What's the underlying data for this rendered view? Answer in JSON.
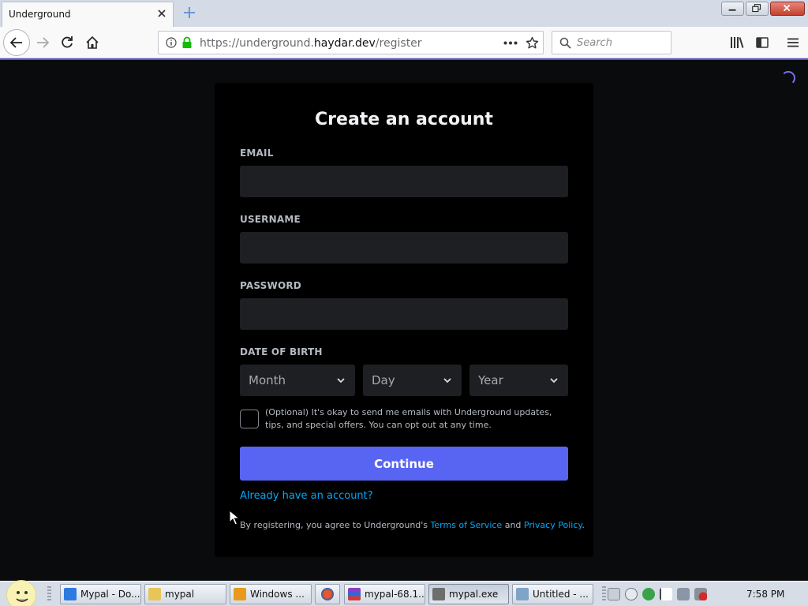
{
  "browser": {
    "tab_title": "Underground",
    "url_prefix": "https://underground.",
    "url_domain": "haydar.dev",
    "url_path": "/register",
    "search_placeholder": "Search"
  },
  "form": {
    "title": "Create an account",
    "email_label": "EMAIL",
    "username_label": "USERNAME",
    "password_label": "PASSWORD",
    "dob_label": "DATE OF BIRTH",
    "month_placeholder": "Month",
    "day_placeholder": "Day",
    "year_placeholder": "Year",
    "optin_text": "(Optional) It's okay to send me emails with Underground updates, tips, and special offers. You can opt out at any time.",
    "continue_label": "Continue",
    "login_link": "Already have an account?",
    "legal_prefix": "By registering, you agree to Underground's ",
    "terms_link": "Terms of Service",
    "legal_and": " and ",
    "privacy_link": "Privacy Policy",
    "legal_suffix": "."
  },
  "colors": {
    "accent": "#5865f2",
    "link": "#00a8fc",
    "card_bg": "#000000",
    "input_bg": "#1e1f22",
    "page_bg": "#0a0b0d"
  },
  "taskbar": {
    "items": [
      {
        "label": "Mypal - Do...",
        "icon": "ie-icon"
      },
      {
        "label": "mypal",
        "icon": "folder-icon"
      },
      {
        "label": "Windows ...",
        "icon": "media-player-icon"
      },
      {
        "label": "",
        "icon": "firefox-icon"
      },
      {
        "label": "mypal-68.1...",
        "icon": "winrar-icon"
      },
      {
        "label": "mypal.exe",
        "icon": "installer-icon"
      },
      {
        "label": "Untitled - ...",
        "icon": "paint-icon"
      }
    ],
    "clock": "7:58 PM"
  }
}
